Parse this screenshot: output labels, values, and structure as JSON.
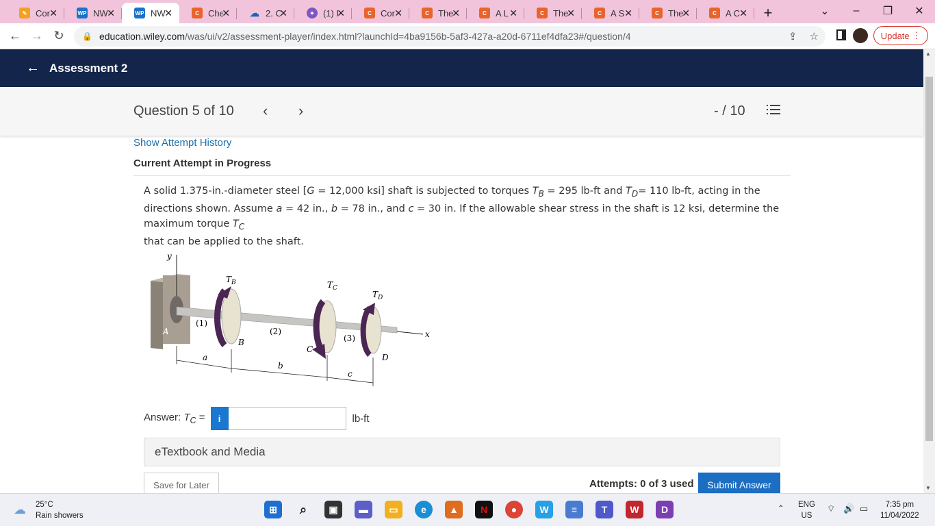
{
  "browser": {
    "tabs": [
      {
        "label": "Cor",
        "favicon": "pencil-icon"
      },
      {
        "label": "NW",
        "favicon": "wp-icon"
      },
      {
        "label": "NW",
        "favicon": "wp-icon",
        "active": true
      },
      {
        "label": "Che",
        "favicon": "c-icon"
      },
      {
        "label": "2. C",
        "favicon": "cloud-icon"
      },
      {
        "label": "(1) I",
        "favicon": "messenger-icon"
      },
      {
        "label": "Cor",
        "favicon": "c-icon"
      },
      {
        "label": "The",
        "favicon": "c-icon"
      },
      {
        "label": "A L",
        "favicon": "c-icon"
      },
      {
        "label": "The",
        "favicon": "c-icon"
      },
      {
        "label": "A S",
        "favicon": "c-icon"
      },
      {
        "label": "The",
        "favicon": "c-icon"
      },
      {
        "label": "A C",
        "favicon": "c-icon"
      }
    ],
    "url_host": "education.wiley.com",
    "url_path": "/was/ui/v2/assessment-player/index.html?launchId=4ba9156b-5af3-427a-a20d-6711ef4dfa23#/question/4",
    "update_label": "Update"
  },
  "header": {
    "title": "Assessment 2"
  },
  "question_bar": {
    "title": "Question 5 of 10",
    "score": "- / 10"
  },
  "content": {
    "attempt_history_link": "Show Attempt History",
    "current_attempt": "Current Attempt in Progress",
    "question_text_1": "A solid 1.375-in.-diameter steel [",
    "question_text_2": " = 12,000 ksi] shaft is subjected to torques ",
    "question_text_3": " = 295 lb-ft and ",
    "question_text_4": "= 110 lb-ft, acting in the directions shown. Assume ",
    "question_text_5": " = 42 in., ",
    "question_text_6": " = 78 in., and ",
    "question_text_7": " = 30 in. If the allowable shear stress in the shaft is 12 ksi, determine the maximum torque ",
    "question_text_8": "that can be applied to the shaft.",
    "answer_label": "Answer: ",
    "answer_var": "T",
    "answer_sub": "C",
    "answer_eq": " =",
    "answer_value": "",
    "answer_unit": "lb-ft",
    "etextbook": "eTextbook and Media",
    "save_later": "Save for Later",
    "attempts": "Attempts: 0 of 3 used",
    "submit": "Submit Answer"
  },
  "figure": {
    "labels": {
      "y": "y",
      "x": "x",
      "A": "A",
      "B": "B",
      "C": "C",
      "D": "D",
      "seg1": "(1)",
      "seg2": "(2)",
      "seg3": "(3)",
      "a": "a",
      "b": "b",
      "c": "c",
      "TB": "T",
      "TBsub": "B",
      "TC": "T",
      "TCsub": "C",
      "TD": "T",
      "TDsub": "D"
    }
  },
  "taskbar": {
    "temperature": "25°C",
    "weather": "Rain showers",
    "lang_1": "ENG",
    "lang_2": "US",
    "time": "7:35 pm",
    "date": "11/04/2022"
  }
}
